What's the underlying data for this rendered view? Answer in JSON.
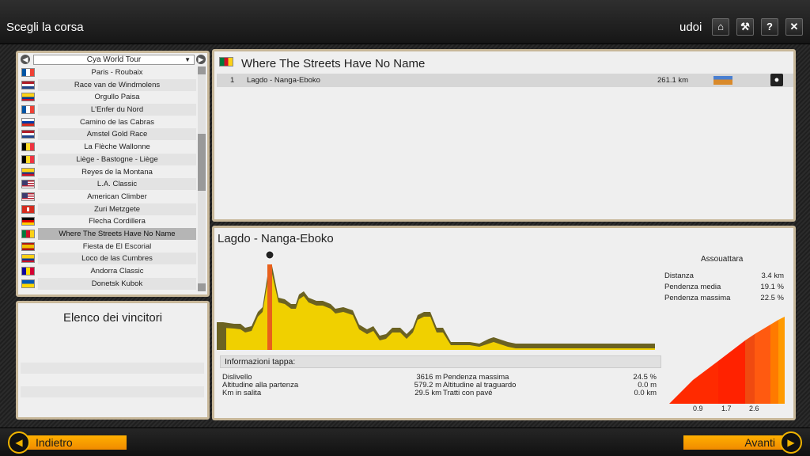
{
  "header": {
    "title": "Scegli la corsa",
    "user": "udoi"
  },
  "icons": {
    "home": "home-icon",
    "settings": "wrench-icon",
    "help": "help-icon",
    "close": "close-icon"
  },
  "tour_selector": {
    "selected": "Cya World Tour"
  },
  "races": [
    {
      "name": "Paris - Roubaix",
      "flag": "fr"
    },
    {
      "name": "Race van de Windmolens",
      "flag": "nl"
    },
    {
      "name": "Orgullo Paisa",
      "flag": "co"
    },
    {
      "name": "L'Enfer du Nord",
      "flag": "fr"
    },
    {
      "name": "Camino de las Cabras",
      "flag": "ru"
    },
    {
      "name": "Amstel Gold Race",
      "flag": "nl"
    },
    {
      "name": "La Flèche Wallonne",
      "flag": "be"
    },
    {
      "name": "Liège - Bastogne - Liège",
      "flag": "be"
    },
    {
      "name": "Reyes de la Montana",
      "flag": "co"
    },
    {
      "name": "L.A. Classic",
      "flag": "us"
    },
    {
      "name": "American Climber",
      "flag": "us"
    },
    {
      "name": "Zuri Metzgete",
      "flag": "ch"
    },
    {
      "name": "Flecha Cordillera",
      "flag": "de"
    },
    {
      "name": "Where The Streets Have No Name",
      "flag": "cm",
      "selected": true
    },
    {
      "name": "Fiesta de El Escorial",
      "flag": "es"
    },
    {
      "name": "Loco de las Cumbres",
      "flag": "co"
    },
    {
      "name": "Andorra Classic",
      "flag": "ad"
    },
    {
      "name": "Donetsk Kubok",
      "flag": "ua"
    }
  ],
  "winners": {
    "title": "Elenco dei vincitori"
  },
  "race": {
    "title": "Where The Streets Have No Name",
    "stages": [
      {
        "num": "1",
        "name": "Lagdo - Nanga-Eboko",
        "distance": "261.1 km"
      }
    ]
  },
  "stage": {
    "title": "Lagdo - Nanga-Eboko",
    "info_title": "Informazioni tappa:",
    "info_left": [
      {
        "label": "Dislivello",
        "value": "3616 m"
      },
      {
        "label": "Altitudine alla partenza",
        "value": "579.2 m"
      },
      {
        "label": "Km in salita",
        "value": "29.5 km"
      }
    ],
    "info_right": [
      {
        "label": "Pendenza massima",
        "value": "24.5 %"
      },
      {
        "label": "Altitudine al traguardo",
        "value": "0.0 m"
      },
      {
        "label": "Tratti con pavé",
        "value": "0.0 km"
      }
    ]
  },
  "climb": {
    "name": "Assouattara",
    "stats": [
      {
        "label": "Distanza",
        "value": "3.4 km"
      },
      {
        "label": "Pendenza media",
        "value": "19.1 %"
      },
      {
        "label": "Pendenza massima",
        "value": "22.5 %"
      }
    ],
    "ticks": [
      "0.9",
      "1.7",
      "2.6"
    ]
  },
  "footer": {
    "back": "Indietro",
    "next": "Avanti"
  },
  "colors": {
    "accent": "#f0b400",
    "panel_border": "#c8b89a",
    "profile_fill": "#f0d000"
  }
}
